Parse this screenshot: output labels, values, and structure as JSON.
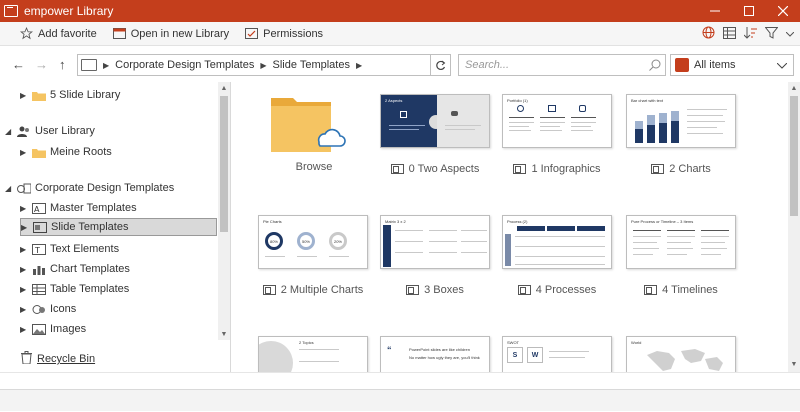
{
  "window": {
    "title": "empower Library",
    "controls": [
      "minimize",
      "maximize",
      "close"
    ]
  },
  "toolbar": {
    "add_favorite": "Add favorite",
    "open_new_library": "Open in new Library",
    "permissions": "Permissions",
    "right_icons": [
      "globe-icon",
      "grid-view-icon",
      "sort-icon",
      "filter-icon",
      "chevron-down-icon"
    ]
  },
  "nav": {
    "breadcrumb": [
      "Corporate Design Templates",
      "Slide Templates"
    ],
    "search_placeholder": "Search...",
    "filter_value": "All items"
  },
  "sidebar": {
    "items": [
      {
        "label": "5 Slide Library",
        "icon": "folder-icon",
        "expander": "collapsed"
      },
      {
        "label": "User Library",
        "icon": "users-icon",
        "expander": "expanded"
      },
      {
        "label": "Meine Roots",
        "icon": "folder-icon",
        "expander": "collapsed"
      },
      {
        "label": "Corporate Design Templates",
        "icon": "corporate-library-icon",
        "expander": "expanded"
      },
      {
        "label": "Master Templates",
        "icon": "master-templates-icon",
        "expander": "collapsed"
      },
      {
        "label": "Slide Templates",
        "icon": "slide-templates-icon",
        "expander": "collapsed",
        "selected": true
      },
      {
        "label": "Text Elements",
        "icon": "text-elements-icon",
        "expander": "collapsed"
      },
      {
        "label": "Chart Templates",
        "icon": "chart-templates-icon",
        "expander": "collapsed"
      },
      {
        "label": "Table Templates",
        "icon": "table-templates-icon",
        "expander": "collapsed"
      },
      {
        "label": "Icons",
        "icon": "icons-icon",
        "expander": "collapsed"
      },
      {
        "label": "Images",
        "icon": "images-icon",
        "expander": "collapsed"
      }
    ],
    "recycle_bin": "Recycle Bin"
  },
  "grid": {
    "items": [
      {
        "label": "Browse",
        "kind": "browse-folder"
      },
      {
        "label": "0 Two Aspects",
        "kind": "two-aspects",
        "thumb_title": "2 Aspects"
      },
      {
        "label": "1 Infographics",
        "kind": "infographics",
        "thumb_title": "Portfolio (1)"
      },
      {
        "label": "2 Charts",
        "kind": "charts",
        "thumb_title": "Bar chart with text"
      },
      {
        "label": "2 Multiple Charts",
        "kind": "multiple-charts",
        "thumb_title": "Pie Charts",
        "pcts": [
          "80%",
          "50%",
          "20%"
        ]
      },
      {
        "label": "3 Boxes",
        "kind": "boxes",
        "thumb_title": "Matrix 3 x 2"
      },
      {
        "label": "4 Processes",
        "kind": "processes",
        "thumb_title": "Process (2)"
      },
      {
        "label": "4 Timelines",
        "kind": "timelines",
        "thumb_title": "Pure Process or Timeline – 3 Items"
      },
      {
        "label": "",
        "kind": "topics",
        "thumb_title": "2 Topics"
      },
      {
        "label": "",
        "kind": "quote",
        "thumb_title": "",
        "quote_lines": [
          "PowerPoint slides are like children",
          "No matter how ugly they are, you'll think"
        ]
      },
      {
        "label": "",
        "kind": "swot",
        "thumb_title": "SWOT",
        "letters": [
          "S",
          "W"
        ]
      },
      {
        "label": "",
        "kind": "world",
        "thumb_title": "World"
      }
    ]
  },
  "colors": {
    "titlebar": "#c43e1c",
    "navy": "#1f3864",
    "folder": "#f5c462",
    "cloud": "#2e74b5"
  }
}
